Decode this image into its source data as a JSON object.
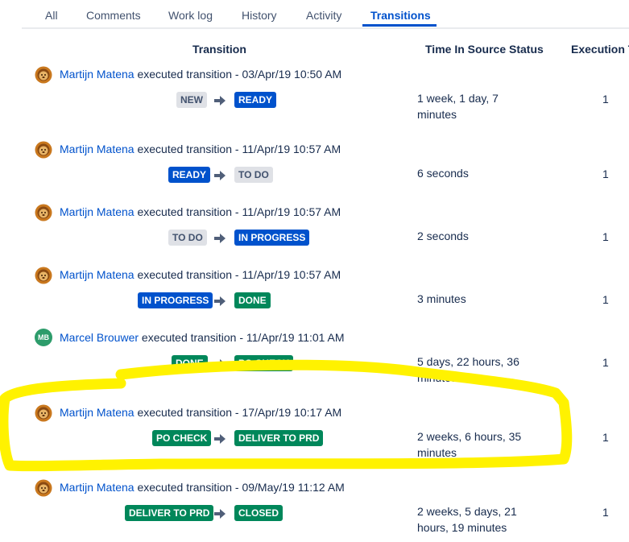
{
  "tabs": [
    {
      "label": "All"
    },
    {
      "label": "Comments"
    },
    {
      "label": "Work log"
    },
    {
      "label": "History"
    },
    {
      "label": "Activity"
    },
    {
      "label": "Transitions"
    }
  ],
  "active_tab": "Transitions",
  "columns": {
    "transition": "Transition",
    "time_in_source": "Time In Source Status",
    "execution": "Execution T"
  },
  "rows": [
    {
      "actor": "Martijn Matena",
      "action": "executed transition - 03/Apr/19 10:50 AM",
      "from": "NEW",
      "to": "READY",
      "time": "1 week, 1 day, 7 minutes",
      "count": "1"
    },
    {
      "actor": "Martijn Matena",
      "action": "executed transition - 11/Apr/19 10:57 AM",
      "from": "READY",
      "to": "TO DO",
      "time": "6 seconds",
      "count": "1"
    },
    {
      "actor": "Martijn Matena",
      "action": "executed transition - 11/Apr/19 10:57 AM",
      "from": "TO DO",
      "to": "IN PROGRESS",
      "time": "2 seconds",
      "count": "1"
    },
    {
      "actor": "Martijn Matena",
      "action": "executed transition - 11/Apr/19 10:57 AM",
      "from": "IN PROGRESS",
      "to": "DONE",
      "time": "3 minutes",
      "count": "1"
    },
    {
      "actor": "Marcel Brouwer",
      "avatar_initials": "MB",
      "action": "executed transition - 11/Apr/19 11:01 AM",
      "from": "DONE",
      "to": "PO CHECK",
      "time": "5 days, 22 hours, 36 minutes",
      "count": "1"
    },
    {
      "actor": "Martijn Matena",
      "action": "executed transition - 17/Apr/19 10:17 AM",
      "from": "PO CHECK",
      "to": "DELIVER TO PRD",
      "time": "2 weeks, 6 hours, 35 minutes",
      "count": "1"
    },
    {
      "actor": "Martijn Matena",
      "action": "executed transition - 09/May/19 11:12 AM",
      "from": "DELIVER TO PRD",
      "to": "CLOSED",
      "time": "2 weeks, 5 days, 21 hours, 19 minutes",
      "count": "1"
    }
  ],
  "icons": {
    "avatar_default": "lion-avatar-icon",
    "arrow": "arrow-right-icon"
  },
  "colors": {
    "link": "#0052cc",
    "lozenge_grey": "#dfe1e6",
    "lozenge_blue": "#0052cc",
    "lozenge_green": "#00875a",
    "highlight": "#fff200"
  }
}
